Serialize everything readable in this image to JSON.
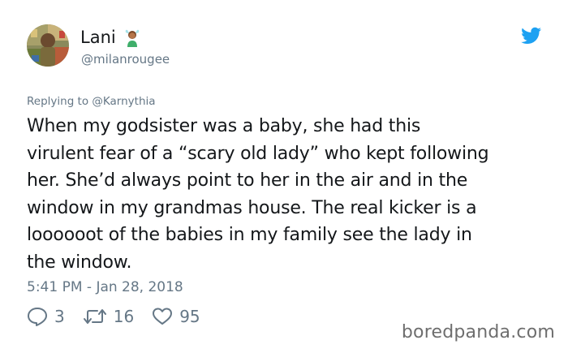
{
  "user": {
    "display_name": "Lani",
    "handle": "@milanrougee",
    "avatar_icon": "avatar-photo",
    "name_emoji": "person-gesturing-ok-emoji"
  },
  "header": {
    "brand_icon": "twitter-bird-icon",
    "brand_color": "#1da1f2"
  },
  "tweet": {
    "replying_to": "Replying to @Karnythia",
    "lines": [
      "When my godsister was a baby, she had this",
      "virulent fear of a “scary old lady” who kept following",
      "her. She’d always point to her in the air and in the",
      "window in my grandmas house. The real kicker is a",
      "loooooot of the babies in my family see the lady in",
      "the window."
    ],
    "timestamp": "5:41 PM - Jan 28, 2018"
  },
  "actions": {
    "replies": "3",
    "retweets": "16",
    "likes": "95"
  },
  "watermark": "boredpanda.com",
  "colors": {
    "text": "#14171a",
    "secondary": "#657786",
    "background": "#ffffff"
  }
}
